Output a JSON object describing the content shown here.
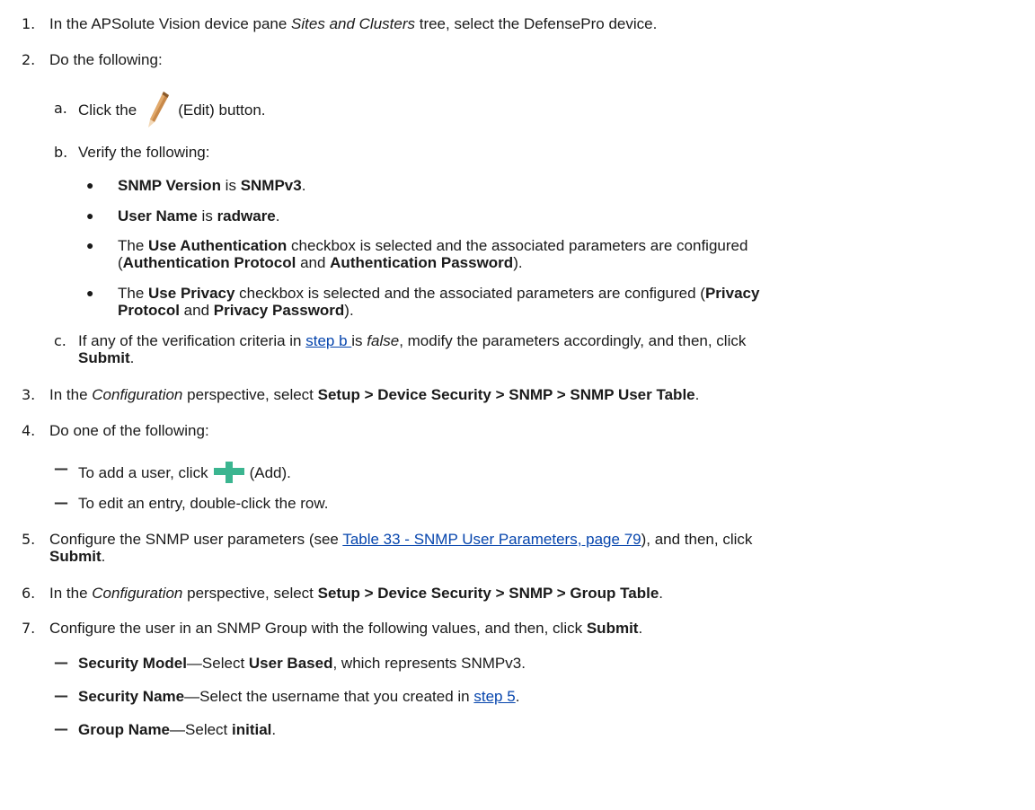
{
  "steps": {
    "s1": {
      "num": "1.",
      "t1": "In the APSolute Vision device pane ",
      "t2": "Sites and Clusters",
      "t3": " tree, select the DefensePro device."
    },
    "s2": {
      "num": "2.",
      "t1": "Do the following:"
    },
    "s2a": {
      "num": "a.",
      "t1": "Click the",
      "t2": "(Edit) button.",
      "icon": "pencil-icon"
    },
    "s2b": {
      "num": "b.",
      "t1": "Verify the following:"
    },
    "bullets": {
      "b1": {
        "t1": "SNMP Version",
        "t2": " is ",
        "t3": "SNMPv3",
        "t4": "."
      },
      "b2": {
        "t1": "User Name",
        "t2": " is ",
        "t3": "radware",
        "t4": "."
      },
      "b3": {
        "t1": "The ",
        "t2": "Use Authentication",
        "t3": " checkbox is selected and the associated parameters are  configured",
        "t4": "(",
        "t5": "Authentication Protocol",
        "t6": " and ",
        "t7": "Authentication Password",
        "t8": ")."
      },
      "b4": {
        "t1": "The ",
        "t2": "Use Privacy",
        "t3": " checkbox is selected and the associated parameters are configured  (",
        "t4": "Privacy",
        "t5": "Protocol",
        "t6": " and ",
        "t7": "Privacy Password",
        "t8": ")."
      }
    },
    "s2c": {
      "num": "c.",
      "t1": "If any of the verification criteria in ",
      "link": "step b ",
      "t2": "is ",
      "t3": "false",
      "t4": ", modify the parameters accordingly, and  then, click",
      "t5": "Submit",
      "t6": "."
    },
    "s3": {
      "num": "3.",
      "t1": "In the ",
      "t2": "Configuration",
      "t3": " perspective, select ",
      "t4": "Setup > Device Security > SNMP > SNMP User  Table",
      "t5": "."
    },
    "s4": {
      "num": "4.",
      "t1": "Do one of the following:"
    },
    "s4d1": {
      "t1": "To add a user, click",
      "t2": "(Add).",
      "icon": "plus-icon"
    },
    "s4d2": {
      "t1": "To edit an entry, double-click the row."
    },
    "s5": {
      "num": "5.",
      "t1": "Configure the SNMP user parameters (see ",
      "link": "Table 33 - SNMP User Parameters, page 79",
      "t2": "), and  then, click",
      "t3": "Submit",
      "t4": "."
    },
    "s6": {
      "num": "6.",
      "t1": "In the ",
      "t2": "Configuration",
      "t3": " perspective, select ",
      "t4": "Setup > Device Security > SNMP > Group Table",
      "t5": "."
    },
    "s7": {
      "num": "7.",
      "t1": "Configure the user in an SNMP Group with the following values, and then, click ",
      "t2": "Submit",
      "t3": "."
    },
    "s7d1": {
      "t1": "Security Model",
      "t2": "—Select ",
      "t3": "User Based",
      "t4": ", which represents SNMPv3."
    },
    "s7d2": {
      "t1": "Security Name",
      "t2": "—Select the username that you created in ",
      "link": "step 5",
      "t3": "."
    },
    "s7d3": {
      "t1": "Group Name",
      "t2": "—Select ",
      "t3": "initial",
      "t4": "."
    }
  },
  "colors": {
    "link": "#0645ad",
    "pencil": "#b97a3a",
    "plus": "#2fae8e"
  }
}
